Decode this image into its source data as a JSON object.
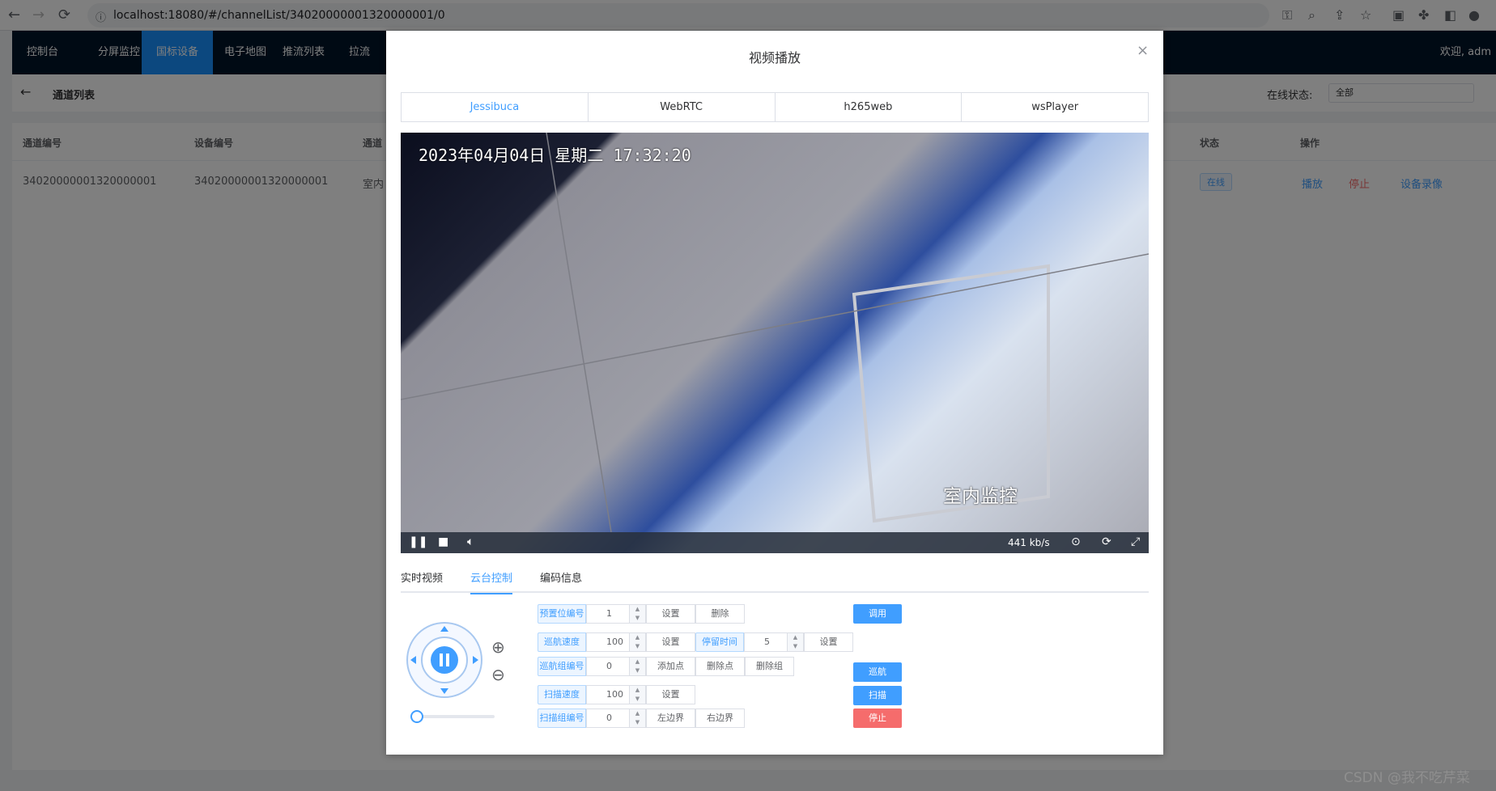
{
  "browser": {
    "url": "localhost:18080/#/channelList/34020000001320000001/0"
  },
  "nav": {
    "items": [
      "控制台",
      "分屏监控",
      "国标设备",
      "电子地图",
      "推流列表",
      "拉流"
    ],
    "welcome": "欢迎, adm"
  },
  "subheader": {
    "title": "通道列表",
    "status_label": "在线状态:",
    "status_value": "全部"
  },
  "table": {
    "headers": [
      "通道编号",
      "设备编号",
      "通道",
      "状态",
      "操作"
    ],
    "row": {
      "channel_id": "34020000001320000001",
      "device_id": "34020000001320000001",
      "name": "室内",
      "status": "在线",
      "actions": [
        "播放",
        "停止",
        "设备录像"
      ]
    }
  },
  "dialog": {
    "title": "视频播放",
    "player_tabs": [
      "Jessibuca",
      "WebRTC",
      "h265web",
      "wsPlayer"
    ],
    "osd_time": "2023年04月04日 星期二 17:32:20",
    "osd_name": "室内监控",
    "bitrate": "441 kb/s",
    "control_tabs": [
      "实时视频",
      "云台控制",
      "编码信息"
    ],
    "ptz": {
      "preset_label": "预置位编号",
      "preset_value": "1",
      "set": "设置",
      "delete": "删除",
      "call": "调用",
      "cruise_speed_label": "巡航速度",
      "cruise_speed_value": "100",
      "stay_time_label": "停留时间",
      "stay_time_value": "5",
      "cruise_group_label": "巡航组编号",
      "cruise_group_value": "0",
      "add_point": "添加点",
      "delete_point": "删除点",
      "delete_group": "删除组",
      "cruise": "巡航",
      "scan_speed_label": "扫描速度",
      "scan_speed_value": "100",
      "scan_group_label": "扫描组编号",
      "scan_group_value": "0",
      "left_boundary": "左边界",
      "right_boundary": "右边界",
      "scan": "扫描",
      "stop": "停止"
    }
  },
  "watermark": "CSDN @我不吃芹菜",
  "colors": {
    "primary": "#409eff",
    "danger": "#f56c6c",
    "nav_bg": "#001529"
  }
}
